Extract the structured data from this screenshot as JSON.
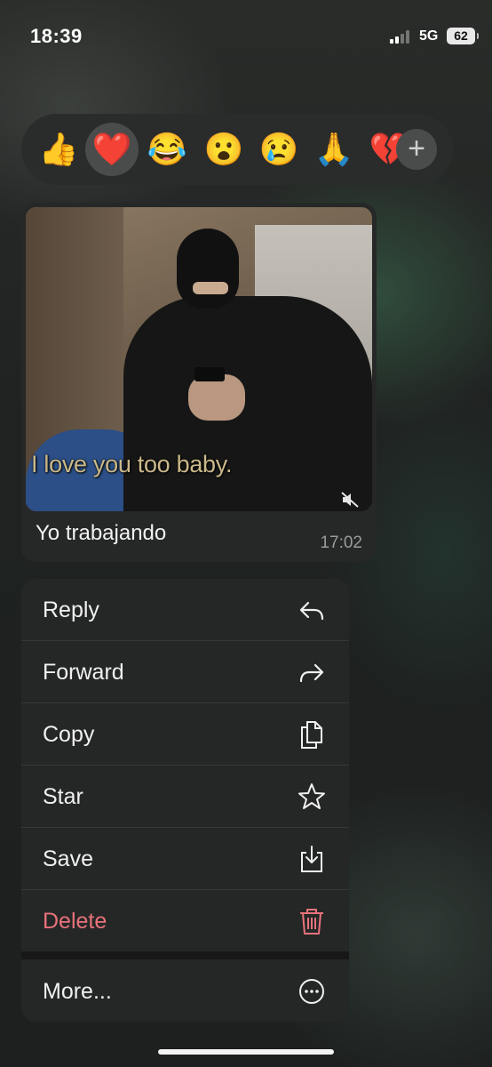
{
  "status_bar": {
    "time": "18:39",
    "network": "5G",
    "battery": "62"
  },
  "reactions": {
    "emojis": [
      "👍",
      "❤️",
      "😂",
      "😮",
      "😢",
      "🙏",
      "💔"
    ],
    "selected": "❤️",
    "more_label": "+"
  },
  "message": {
    "video_caption": "I love you too baby.",
    "text": "Yo trabajando",
    "time": "17:02"
  },
  "menu": {
    "reply": "Reply",
    "forward": "Forward",
    "copy": "Copy",
    "star": "Star",
    "save": "Save",
    "delete": "Delete",
    "more": "More..."
  },
  "colors": {
    "danger": "#e8727b",
    "menu_bg": "#252726"
  }
}
